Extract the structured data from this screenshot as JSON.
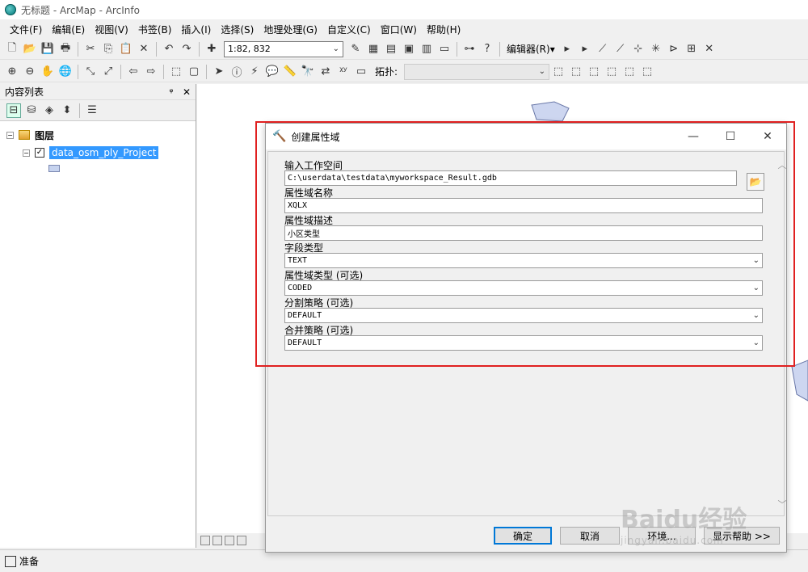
{
  "window": {
    "title": "无标题 - ArcMap - ArcInfo"
  },
  "menu": [
    "文件(F)",
    "编辑(E)",
    "视图(V)",
    "书签(B)",
    "插入(I)",
    "选择(S)",
    "地理处理(G)",
    "自定义(C)",
    "窗口(W)",
    "帮助(H)"
  ],
  "toolbar": {
    "scale": "1:82, 832",
    "editor_label": "编辑器(R)▾",
    "topology_label": "拓扑:"
  },
  "toc": {
    "title": "内容列表",
    "pin": "ᵠ",
    "close": "✕",
    "root_label": "图层",
    "layer_name": "data_osm_ply_Project"
  },
  "dialog": {
    "title": "创建属性域",
    "fields": [
      {
        "label": "输入工作空间",
        "value": "C:\\userdata\\testdata\\myworkspace_Result.gdb"
      },
      {
        "label": "属性域名称",
        "value": "XQLX"
      },
      {
        "label": "属性域描述",
        "value": "小区类型"
      },
      {
        "label": "字段类型",
        "value": "TEXT"
      },
      {
        "label": "属性域类型 (可选)",
        "value": "CODED"
      },
      {
        "label": "分割策略 (可选)",
        "value": "DEFAULT"
      },
      {
        "label": "合并策略 (可选)",
        "value": "DEFAULT"
      }
    ],
    "buttons": {
      "ok": "确定",
      "cancel": "取消",
      "env": "环境...",
      "help": "显示帮助 >>"
    }
  },
  "statusbar": {
    "label": "准备"
  },
  "watermark": {
    "brand": "Baidu经验",
    "url": "jingyan.baidu.com"
  }
}
